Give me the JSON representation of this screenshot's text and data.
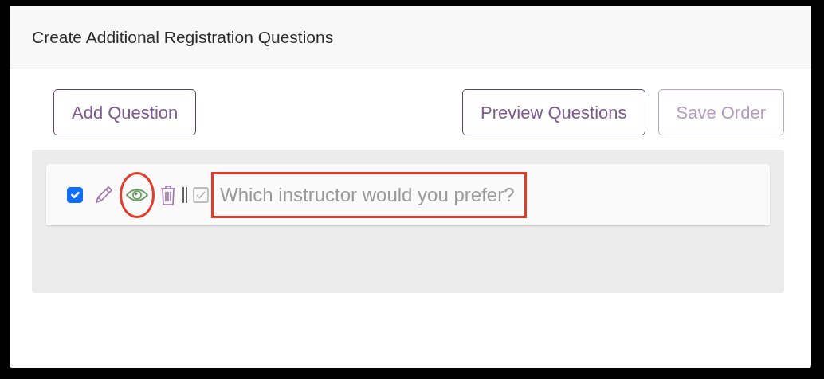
{
  "panel": {
    "title": "Create Additional Registration Questions"
  },
  "buttons": [
    {
      "label": "Add Question",
      "disabled": false
    },
    {
      "label": "Preview Questions",
      "disabled": false
    },
    {
      "label": "Save Order",
      "disabled": true
    }
  ],
  "questions": [
    {
      "checked": true,
      "visible": true,
      "annotated": true,
      "text": "Which instructor would you prefer?"
    }
  ]
}
